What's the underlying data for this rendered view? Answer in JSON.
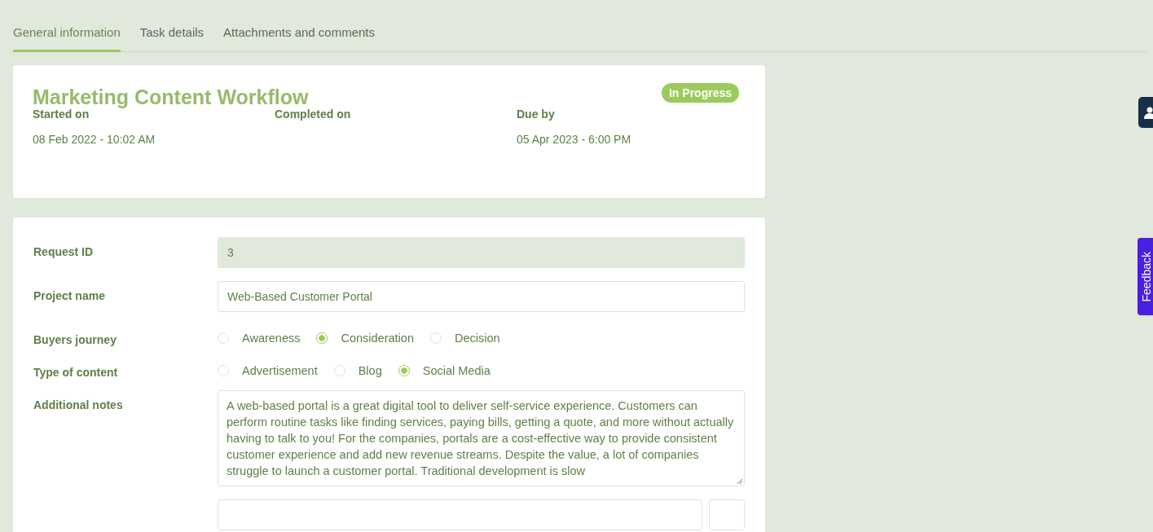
{
  "tabs": [
    {
      "label": "General information",
      "selected": true
    },
    {
      "label": "Task details",
      "selected": false
    },
    {
      "label": "Attachments and comments",
      "selected": false
    }
  ],
  "summary": {
    "title": "Marketing Content Workflow",
    "status": "In Progress",
    "dates": [
      {
        "label": "Started on",
        "value": "08 Feb 2022 - 10:02 AM"
      },
      {
        "label": "Completed on"
      },
      {
        "label": "Due by",
        "value": "05 Apr 2023 - 6:00 PM"
      }
    ]
  },
  "form": [
    {
      "kind": "text",
      "label": "Request ID",
      "value": "3",
      "disabled": true
    },
    {
      "kind": "text",
      "label": "Project name",
      "value": "Web-Based Customer Portal",
      "disabled": false
    },
    {
      "kind": "radio",
      "label": "Buyers journey",
      "options": [
        {
          "label": "Awareness",
          "selected": false
        },
        {
          "label": "Consideration",
          "selected": true
        },
        {
          "label": "Decision",
          "selected": false
        }
      ]
    },
    {
      "kind": "radio",
      "label": "Type of content",
      "options": [
        {
          "label": "Advertisement",
          "selected": false
        },
        {
          "label": "Blog",
          "selected": false
        },
        {
          "label": "Social Media",
          "selected": true
        }
      ]
    },
    {
      "kind": "textarea",
      "label": "Additional notes",
      "value": "A web-based portal is a great digital tool to deliver self-service experience. Customers can perform routine tasks like finding services, paying bills, getting a quote, and more without actually having to talk to you! For the companies, portals are a cost-effective way to provide consistent customer experience and add new revenue streams. Despite the value, a lot of companies struggle to launch a customer portal. Traditional development is slow"
    },
    {
      "kind": "date"
    }
  ],
  "side": {
    "feedback": "Feedback"
  }
}
